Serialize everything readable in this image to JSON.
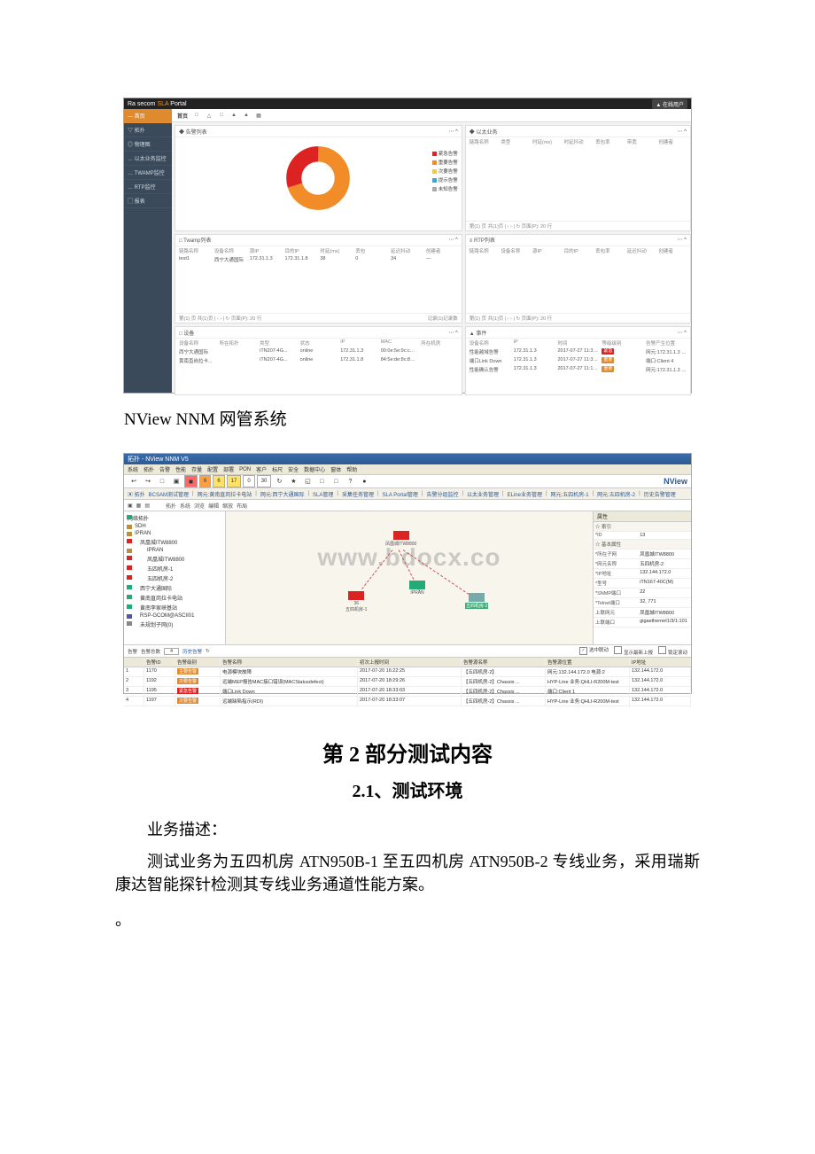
{
  "sla": {
    "brand_prefix": "Ra secom",
    "brand_suffix": " Portal",
    "brand_mid": "SLA",
    "user_tag": "▲ 在线用户",
    "sidebar": [
      {
        "label": "— 首页",
        "active": true
      },
      {
        "label": "▽ 拓扑"
      },
      {
        "label": "◎ 物理图"
      },
      {
        "label": "… 以太业务监控"
      },
      {
        "label": "… TWAMP监控"
      },
      {
        "label": "… RTP监控"
      },
      {
        "label": "▢ 报表"
      }
    ],
    "tab_title": "首页",
    "tab_icons": [
      "□",
      "△",
      "□",
      "▲",
      "▲",
      "▦"
    ],
    "panels": {
      "alarm_pie": {
        "title": "◆ 告警列表",
        "legend": [
          {
            "color": "#d22",
            "label": "紧急告警"
          },
          {
            "color": "#f28c28",
            "label": "重要告警"
          },
          {
            "color": "#f2c94c",
            "label": "次要告警"
          },
          {
            "color": "#3da9c9",
            "label": "提示告警"
          },
          {
            "color": "#aaa",
            "label": "未知告警"
          }
        ]
      },
      "biz_list": {
        "title": "◆ 以太业务",
        "cols": [
          "链路名称",
          "类型",
          "时延(ms)",
          "时延抖动",
          "丢包率",
          "带宽",
          "创建者"
        ]
      },
      "twamp": {
        "title": "□ Twamp列表",
        "cols": [
          "链路名称",
          "设备名称",
          "源IP",
          "目的IP",
          "时延(ms)",
          "丢包",
          "延迟抖动",
          "创建者"
        ],
        "row": [
          "test1",
          "西宁大通国际",
          "172.31.1.3",
          "172.31.1.8",
          "38",
          "0",
          "34",
          "—"
        ]
      },
      "rtp": {
        "title": "≡ RTP列表",
        "cols": [
          "链路名称",
          "设备名称",
          "源IP",
          "目的IP",
          "丢包率",
          "延迟抖动",
          "创建者"
        ]
      },
      "devices": {
        "title": "□ 设备",
        "cols": [
          "设备名称",
          "所在拓扑",
          "类型",
          "状态",
          "IP",
          "MAC",
          "所在机房"
        ],
        "rows": [
          [
            "西宁大通国际",
            "",
            "iTN207-4G...",
            "online",
            "172.31.1.3",
            "00:0e:5e:9c:c0:c9",
            ""
          ],
          [
            "黄南直岗拉卡...",
            "",
            "iTN207-4G...",
            "online",
            "172.31.1.8",
            "84:5e:de:8c:8c:f8",
            ""
          ]
        ]
      },
      "events": {
        "title": "▲ 事件",
        "cols": [
          "设备名称",
          "IP",
          "时间",
          "等级级别",
          "告警产生位置"
        ],
        "rows": [
          [
            "性能越域告警",
            "172.31.1.3",
            "2017-07-27 11:34:49",
            "紧急",
            "网元:172.31.1.3 电源-2"
          ],
          [
            "端口Link Down",
            "172.31.1.3",
            "2017-07-27 11:34:38",
            "重要",
            "端口:Client 4"
          ],
          [
            "性能确认告警",
            "172.31.1.3",
            "2017-07-27 11:13:43",
            "重要",
            "网元:172.31.1.3 电源-2"
          ]
        ]
      },
      "footer_pager": "第(1) 页  共(1)页 | ‹ › | ↻  页面(P): 20  行",
      "footer_pager_r": "记录(1)记录数"
    }
  },
  "caption1": "NView NNM 网管系统",
  "nview": {
    "title": "拓扑 - NView NNM V5",
    "menus": [
      "系统",
      "拓扑",
      "告警",
      "性能",
      "存量",
      "配置",
      "部署",
      "PON",
      "客户",
      "标尺",
      "安全",
      "数据中心",
      "窗体",
      "帮助"
    ],
    "toolbar_icons": [
      "↩",
      "↪",
      "□",
      "▣"
    ],
    "filter_chips": [
      "◼",
      "6",
      "6",
      "17",
      "0",
      "30"
    ],
    "filter_icons": [
      "↻",
      "★"
    ],
    "toolwin_icons": [
      "◱",
      "□",
      "□",
      "?",
      "●"
    ],
    "logo": "NView",
    "breadcrumbs": [
      "BCSAM测试管理",
      "网元:黄南直岗拉卡电站",
      "网元:西宁大通国际",
      "SLA管理",
      "采集任务管理",
      "SLA Portal管理",
      "告警分组监控",
      "以太业务管理",
      "ELine业务管理",
      "网元:五四机房-1",
      "网元:五四机房-2",
      "历史告警管理"
    ],
    "small_toolbar_left": [
      "拓扑",
      "系统",
      "浏览",
      "编辑",
      "缩放",
      "布局"
    ],
    "tree_title": "网络拓扑",
    "tree": [
      {
        "label": "SDH",
        "c": "#b98e3e"
      },
      {
        "label": "IPRAN",
        "c": "#b98e3e"
      },
      {
        "label": "凤凰城ITW8800",
        "c": "#d22",
        "indent": 1
      },
      {
        "label": "IPRAN",
        "c": "#b98e3e",
        "indent": 2
      },
      {
        "label": "凤凰城ITW8800",
        "c": "#d22",
        "indent": 2
      },
      {
        "label": "五四机房-1",
        "c": "#d22",
        "indent": 2
      },
      {
        "label": "五四机房-2",
        "c": "#d22",
        "indent": 2
      },
      {
        "label": "西宁大通国际",
        "c": "#2a7",
        "indent": 1
      },
      {
        "label": "黄南直岗拉卡电站",
        "c": "#2a7",
        "indent": 1
      },
      {
        "label": "黄南李家峡基站",
        "c": "#2a7",
        "indent": 1
      },
      {
        "label": "RSP-GCOM@ASCII01",
        "c": "#55a",
        "indent": 1
      },
      {
        "label": "未规划子网(0)",
        "c": "#888",
        "indent": 1
      }
    ],
    "nodes": {
      "top": {
        "label": "凤凰城ITW8800"
      },
      "left": {
        "label": "五四机房-1",
        "sub": "36"
      },
      "mid": {
        "label": "IPRAN"
      },
      "right": {
        "label": "五四机房-2"
      }
    },
    "watermark": "www.bdocx.co",
    "props_title": "属性",
    "props_section": "☆ 基本属性",
    "props_index": "☆ 索引",
    "props": [
      {
        "k": "*ID",
        "v": "13"
      },
      {
        "k": "*所在子网",
        "v": "凤凰城ITW8800"
      },
      {
        "k": "*网元名称",
        "v": "五四机房-2"
      },
      {
        "k": "*IP地址",
        "v": "132.144.172.0"
      },
      {
        "k": "*型号",
        "v": "iTN167-40C(M)"
      },
      {
        "k": "*SNMP端口",
        "v": "22"
      },
      {
        "k": "*Telnet端口",
        "v": "32, 771"
      },
      {
        "k": "上联网元",
        "v": "凤凰城ITW8800"
      },
      {
        "k": "上联端口",
        "v": "gigaethernet1/3/1:101"
      }
    ],
    "alarm_tab": "告警",
    "alarm_count_label": "告警总数",
    "alarm_count": "4",
    "alarm_history": "历史告警",
    "alarm_opts": [
      "选中联动",
      "显示最新上报",
      "锁定滚动"
    ],
    "alarm_cols": [
      "",
      "告警ID",
      "告警级别",
      "告警名称",
      "初次上报时间",
      "告警源名称",
      "告警源位置",
      "IP地址"
    ],
    "alarm_rows": [
      {
        "n": "1",
        "id": "1170",
        "lvl": "主要告警",
        "lvlc": "major",
        "name": "电源模块故障",
        "time": "2017-07-20 16:22:25",
        "src": "【五四机房-2】",
        "loc": "网元:132.144.172.0 电源:2",
        "ip": "132.144.172.0"
      },
      {
        "n": "2",
        "id": "1192",
        "lvl": "次要告警",
        "lvlc": "major",
        "name": "远端MEP报告MAC接口错误(MACStatusdefect)",
        "time": "2017-07-20 18:29:26",
        "src": "【五四机房-2】Chassis ...",
        "loc": "HYP-Line 业务:QHLI-R200M-test",
        "ip": "132.144.172.0"
      },
      {
        "n": "3",
        "id": "1195",
        "lvl": "紧急告警",
        "lvlc": "crit",
        "name": "端口Link Down",
        "time": "2017-07-20 18:33:03",
        "src": "【五四机房-2】Chassis ...",
        "loc": "端口:Client 1",
        "ip": "132.144.172.0"
      },
      {
        "n": "4",
        "id": "1197",
        "lvl": "次要告警",
        "lvlc": "major",
        "name": "远端缺陷指示(RDI)",
        "time": "2017-07-20 18:33:07",
        "src": "【五四机房-2】Chassis ...",
        "loc": "HYP-Line 业务:QHLI-R200M-test",
        "ip": "132.144.172.0"
      }
    ]
  },
  "doc": {
    "h1": "第 2 部分测试内容",
    "h2": "2.1、测试环境",
    "p1": "业务描述：",
    "p2": "测试业务为五四机房 ATN950B-1 至五四机房 ATN950B-2 专线业务，采用瑞斯康达智能探针检测其专线业务通道性能方案。",
    "p3": "。"
  }
}
